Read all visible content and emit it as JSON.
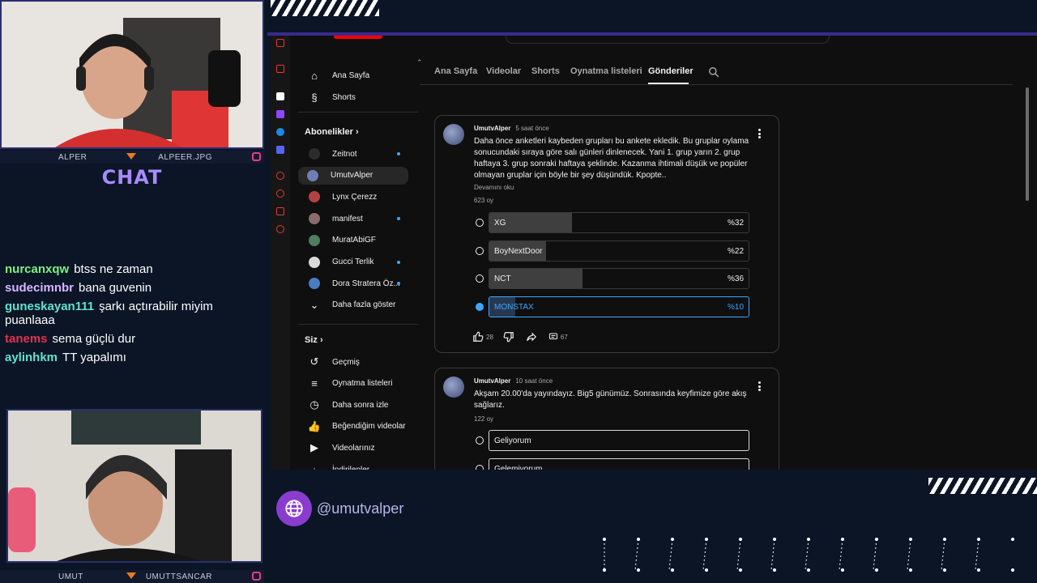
{
  "streamer_cams": {
    "top": {
      "name": "ALPER",
      "social": "ALPEER.JPG"
    },
    "bottom": {
      "name": "UMUT",
      "social": "UMUTTSANCAR"
    }
  },
  "chat": {
    "title": "CHAT",
    "messages": [
      {
        "user": "nurcanxqw",
        "color": "#7cf27c",
        "text": "btss ne zaman"
      },
      {
        "user": "sudecimnbr",
        "color": "#d7b6ff",
        "text": "bana guvenin"
      },
      {
        "user": "guneskayan111",
        "color": "#62e3d0",
        "text": "şarkı açtırabilir miyim puanlaaa"
      },
      {
        "user": "tanems",
        "color": "#e0334f",
        "text": "sema güçlü dur"
      },
      {
        "user": "aylinhkm",
        "color": "#62e3d0",
        "text": "TT yapalımı"
      }
    ]
  },
  "handle": "@umutvalper",
  "youtube": {
    "sidebar": {
      "main": [
        {
          "icon": "home-icon",
          "label": "Ana Sayfa"
        },
        {
          "icon": "shorts-icon",
          "label": "Shorts"
        }
      ],
      "subscriptions_title": "Abonelikler",
      "subscriptions": [
        {
          "label": "Zeitnot",
          "dot": true,
          "color": "#2c2c2c"
        },
        {
          "label": "UmutvAlper",
          "dot": false,
          "active": true,
          "color": "#6f7fb3"
        },
        {
          "label": "Lynx Çerezz",
          "dot": false,
          "color": "#b34242"
        },
        {
          "label": "manifest",
          "dot": true,
          "color": "#8a6b6b"
        },
        {
          "label": "MuratAbiGF",
          "dot": false,
          "color": "#4f7d5f"
        },
        {
          "label": "Gucci Terlik",
          "dot": true,
          "color": "#d9d9d9"
        },
        {
          "label": "Dora Stratera Öz...",
          "dot": true,
          "color": "#4a7cc2"
        }
      ],
      "show_more": "Daha fazla göster",
      "you_title": "Siz",
      "you": [
        {
          "icon": "history-icon",
          "label": "Geçmiş"
        },
        {
          "icon": "playlists-icon",
          "label": "Oynatma listeleri"
        },
        {
          "icon": "watch-later-icon",
          "label": "Daha sonra izle"
        },
        {
          "icon": "liked-icon",
          "label": "Beğendiğim videolar"
        },
        {
          "icon": "your-videos-icon",
          "label": "Videolarınız"
        },
        {
          "icon": "downloads-icon",
          "label": "İndirilenler"
        }
      ]
    },
    "tabs": [
      "Ana Sayfa",
      "Videolar",
      "Shorts",
      "Oynatma listeleri",
      "Gönderiler"
    ],
    "active_tab": "Gönderiler",
    "posts": [
      {
        "author": "UmutvAlper",
        "time": "5 saat önce",
        "text": "Daha önce anketleri kaybeden grupları bu ankete ekledik. Bu gruplar oylama sonucundaki sıraya göre salı günleri dinlenecek. Yani 1. grup yarın 2. grup haftaya 3. grup sonraki haftaya şeklinde. Kazanma ihtimali düşük ve popüler olmayan gruplar için böyle bir şey düşündük. Kpopte..",
        "more": "Devamını oku",
        "votes": "623 oy",
        "options": [
          {
            "label": "XG",
            "pct": "%32",
            "value": 32,
            "selected": false
          },
          {
            "label": "BoyNextDoor",
            "pct": "%22",
            "value": 22,
            "selected": false
          },
          {
            "label": "NCT",
            "pct": "%36",
            "value": 36,
            "selected": false
          },
          {
            "label": "MONSTAX",
            "pct": "%10",
            "value": 10,
            "selected": true
          }
        ],
        "likes": "28",
        "comments": "67"
      },
      {
        "author": "UmutvAlper",
        "time": "10 saat önce",
        "text": "Akşam 20.00'da yayındayız. Big5 günümüz. Sonrasında keyfimize göre akış sağlarız.",
        "votes": "122 oy",
        "options": [
          {
            "label": "Geliyorum"
          },
          {
            "label": "Gelemiyorum"
          }
        ]
      }
    ]
  }
}
